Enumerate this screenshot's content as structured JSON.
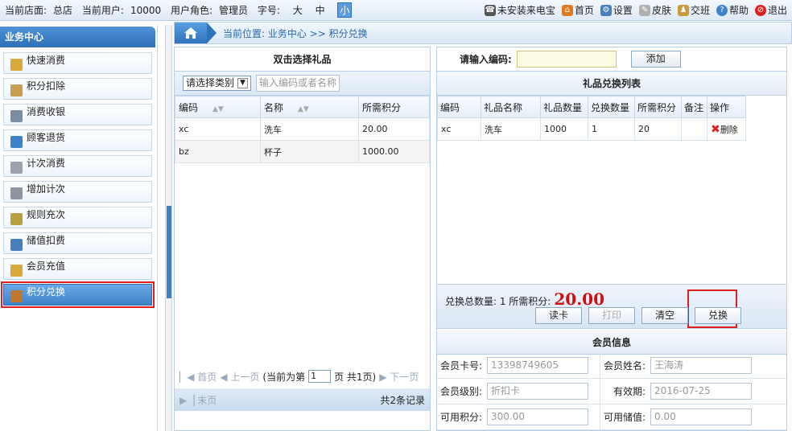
{
  "topbar": {
    "store_label": "当前店面:",
    "store": "总店",
    "user_label": "当前用户:",
    "user": "10000",
    "role_label": "用户角色:",
    "role": "管理员",
    "font_label": "字号:",
    "font_sizes": [
      "大",
      "中",
      "小"
    ],
    "font_active": "小",
    "links": [
      "未安装来电宝",
      "首页",
      "设置",
      "皮肤",
      "交班",
      "帮助",
      "退出"
    ]
  },
  "sidebar": {
    "title": "业务中心",
    "items": [
      {
        "label": "快速消费"
      },
      {
        "label": "积分扣除"
      },
      {
        "label": "消费收银"
      },
      {
        "label": "顾客退货"
      },
      {
        "label": "计次消费"
      },
      {
        "label": "增加计次"
      },
      {
        "label": "规则充次"
      },
      {
        "label": "储值扣费"
      },
      {
        "label": "会员充值"
      },
      {
        "label": "积分兑换"
      }
    ],
    "active_index": 9
  },
  "breadcrumb": "当前位置: 业务中心 >> 积分兑换",
  "gift_panel": {
    "title": "双击选择礼品",
    "category_select": "请选择类别",
    "search_placeholder": "输入编码或者名称",
    "columns": [
      "编码",
      "名称",
      "所需积分"
    ],
    "rows": [
      [
        "xc",
        "洗车",
        "20.00"
      ],
      [
        "bz",
        "杯子",
        "1000.00"
      ]
    ],
    "pager": {
      "first": "首页",
      "prev": "上一页",
      "current_prefix": "(当前为第",
      "page": "1",
      "suffix": "页 共1页)",
      "next": "下一页",
      "last": "末页",
      "total": "共2条记录"
    }
  },
  "exchange_panel": {
    "code_label": "请输入编码:",
    "add_button": "添加",
    "list_title": "礼品兑换列表",
    "columns": [
      "编码",
      "礼品名称",
      "礼品数量",
      "兑换数量",
      "所需积分",
      "备注",
      "操作"
    ],
    "rows": [
      [
        "xc",
        "洗车",
        "1000",
        "1",
        "20",
        "",
        "删除"
      ]
    ],
    "summary_text": "兑换总数量: 1 所需积分:",
    "summary_points": "20.00",
    "buttons": [
      "读卡",
      "打印",
      "清空",
      "兑换"
    ]
  },
  "member_info": {
    "title": "会员信息",
    "card_label": "会员卡号:",
    "card": "13398749605",
    "name_label": "会员姓名:",
    "name": "王海涛",
    "level_label": "会员级别:",
    "level": "折扣卡",
    "expiry_label": "有效期:",
    "expiry": "2016-07-25",
    "points_label": "可用积分:",
    "points": "300.00",
    "balance_label": "可用储值:",
    "balance": "0.00"
  },
  "colors": {
    "accent": "#2e6fb7",
    "highlight": "#e02020"
  }
}
